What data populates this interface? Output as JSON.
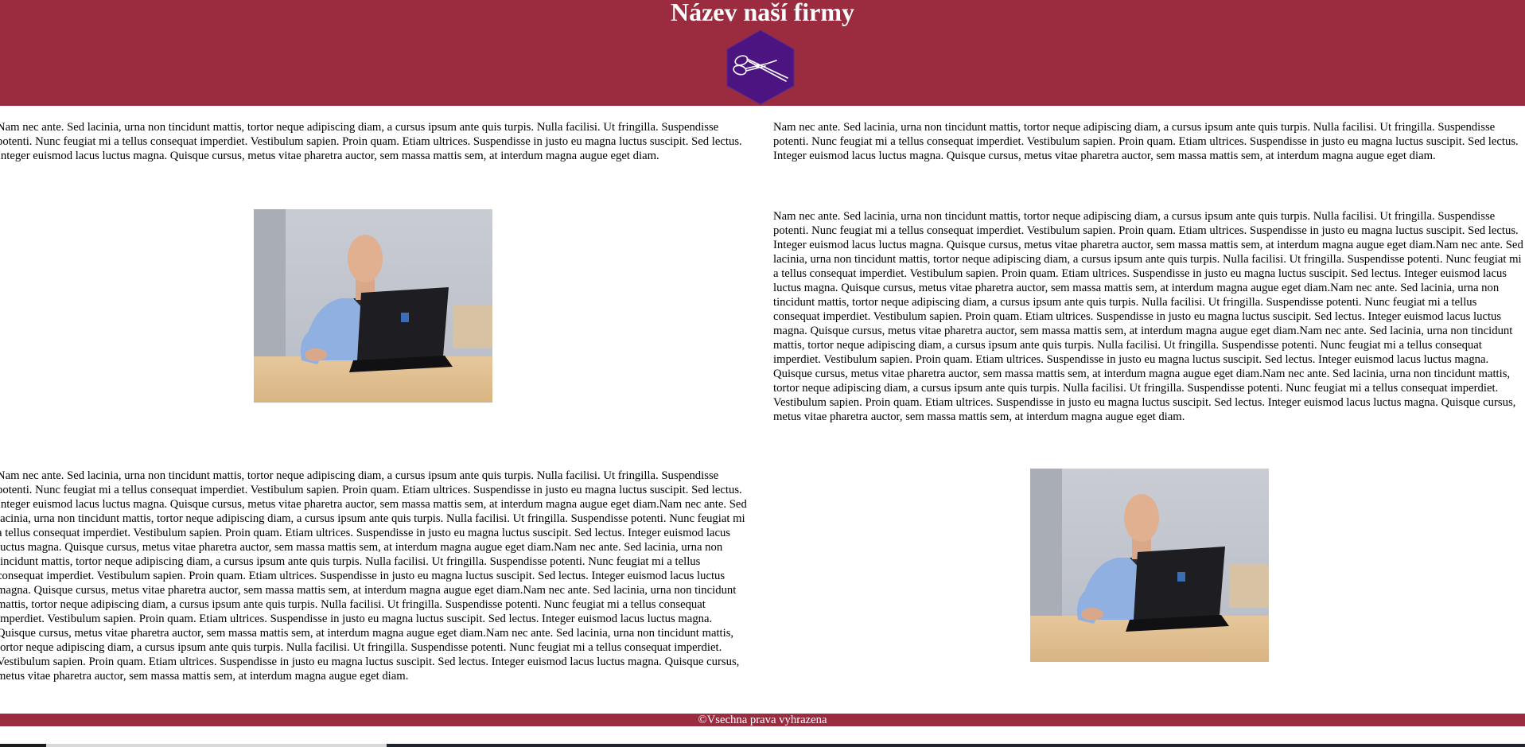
{
  "header": {
    "title": "Název naší firmy",
    "logo_icon": "scissors-hexagon-icon",
    "background_color": "#9b2b3f",
    "logo_color": "#4b1480"
  },
  "content": {
    "top_left_paragraph": "Nam nec ante. Sed lacinia, urna non tincidunt mattis, tortor neque adipiscing diam, a cursus ipsum ante quis turpis. Nulla facilisi. Ut fringilla. Suspendisse potenti. Nunc feugiat mi a tellus consequat imperdiet. Vestibulum sapien. Proin quam. Etiam ultrices. Suspendisse in justo eu magna luctus suscipit. Sed lectus. Integer euismod lacus luctus magna. Quisque cursus, metus vitae pharetra auctor, sem massa mattis sem, at interdum magna augue eget diam.",
    "top_right_paragraph": "Nam nec ante. Sed lacinia, urna non tincidunt mattis, tortor neque adipiscing diam, a cursus ipsum ante quis turpis. Nulla facilisi. Ut fringilla. Suspendisse potenti. Nunc feugiat mi a tellus consequat imperdiet. Vestibulum sapien. Proin quam. Etiam ultrices. Suspendisse in justo eu magna luctus suscipit. Sed lectus. Integer euismod lacus luctus magna. Quisque cursus, metus vitae pharetra auctor, sem massa mattis sem, at interdum magna augue eget diam.",
    "right_long_paragraph": "Nam nec ante. Sed lacinia, urna non tincidunt mattis, tortor neque adipiscing diam, a cursus ipsum ante quis turpis. Nulla facilisi. Ut fringilla. Suspendisse potenti. Nunc feugiat mi a tellus consequat imperdiet. Vestibulum sapien. Proin quam. Etiam ultrices. Suspendisse in justo eu magna luctus suscipit. Sed lectus. Integer euismod lacus luctus magna. Quisque cursus, metus vitae pharetra auctor, sem massa mattis sem, at interdum magna augue eget diam.Nam nec ante. Sed lacinia, urna non tincidunt mattis, tortor neque adipiscing diam, a cursus ipsum ante quis turpis. Nulla facilisi. Ut fringilla. Suspendisse potenti. Nunc feugiat mi a tellus consequat imperdiet. Vestibulum sapien. Proin quam. Etiam ultrices. Suspendisse in justo eu magna luctus suscipit. Sed lectus. Integer euismod lacus luctus magna. Quisque cursus, metus vitae pharetra auctor, sem massa mattis sem, at interdum magna augue eget diam.Nam nec ante. Sed lacinia, urna non tincidunt mattis, tortor neque adipiscing diam, a cursus ipsum ante quis turpis. Nulla facilisi. Ut fringilla. Suspendisse potenti. Nunc feugiat mi a tellus consequat imperdiet. Vestibulum sapien. Proin quam. Etiam ultrices. Suspendisse in justo eu magna luctus suscipit. Sed lectus. Integer euismod lacus luctus magna. Quisque cursus, metus vitae pharetra auctor, sem massa mattis sem, at interdum magna augue eget diam.Nam nec ante. Sed lacinia, urna non tincidunt mattis, tortor neque adipiscing diam, a cursus ipsum ante quis turpis. Nulla facilisi. Ut fringilla. Suspendisse potenti. Nunc feugiat mi a tellus consequat imperdiet. Vestibulum sapien. Proin quam. Etiam ultrices. Suspendisse in justo eu magna luctus suscipit. Sed lectus. Integer euismod lacus luctus magna. Quisque cursus, metus vitae pharetra auctor, sem massa mattis sem, at interdum magna augue eget diam.Nam nec ante. Sed lacinia, urna non tincidunt mattis, tortor neque adipiscing diam, a cursus ipsum ante quis turpis. Nulla facilisi. Ut fringilla. Suspendisse potenti. Nunc feugiat mi a tellus consequat imperdiet. Vestibulum sapien. Proin quam. Etiam ultrices. Suspendisse in justo eu magna luctus suscipit. Sed lectus. Integer euismod lacus luctus magna. Quisque cursus, metus vitae pharetra auctor, sem massa mattis sem, at interdum magna augue eget diam.",
    "left_long_paragraph": "Nam nec ante. Sed lacinia, urna non tincidunt mattis, tortor neque adipiscing diam, a cursus ipsum ante quis turpis. Nulla facilisi. Ut fringilla. Suspendisse potenti. Nunc feugiat mi a tellus consequat imperdiet. Vestibulum sapien. Proin quam. Etiam ultrices. Suspendisse in justo eu magna luctus suscipit. Sed lectus. Integer euismod lacus luctus magna. Quisque cursus, metus vitae pharetra auctor, sem massa mattis sem, at interdum magna augue eget diam.Nam nec ante. Sed lacinia, urna non tincidunt mattis, tortor neque adipiscing diam, a cursus ipsum ante quis turpis. Nulla facilisi. Ut fringilla. Suspendisse potenti. Nunc feugiat mi a tellus consequat imperdiet. Vestibulum sapien. Proin quam. Etiam ultrices. Suspendisse in justo eu magna luctus suscipit. Sed lectus. Integer euismod lacus luctus magna. Quisque cursus, metus vitae pharetra auctor, sem massa mattis sem, at interdum magna augue eget diam.Nam nec ante. Sed lacinia, urna non tincidunt mattis, tortor neque adipiscing diam, a cursus ipsum ante quis turpis. Nulla facilisi. Ut fringilla. Suspendisse potenti. Nunc feugiat mi a tellus consequat imperdiet. Vestibulum sapien. Proin quam. Etiam ultrices. Suspendisse in justo eu magna luctus suscipit. Sed lectus. Integer euismod lacus luctus magna. Quisque cursus, metus vitae pharetra auctor, sem massa mattis sem, at interdum magna augue eget diam.Nam nec ante. Sed lacinia, urna non tincidunt mattis, tortor neque adipiscing diam, a cursus ipsum ante quis turpis. Nulla facilisi. Ut fringilla. Suspendisse potenti. Nunc feugiat mi a tellus consequat imperdiet. Vestibulum sapien. Proin quam. Etiam ultrices. Suspendisse in justo eu magna luctus suscipit. Sed lectus. Integer euismod lacus luctus magna. Quisque cursus, metus vitae pharetra auctor, sem massa mattis sem, at interdum magna augue eget diam.Nam nec ante. Sed lacinia, urna non tincidunt mattis, tortor neque adipiscing diam, a cursus ipsum ante quis turpis. Nulla facilisi. Ut fringilla. Suspendisse potenti. Nunc feugiat mi a tellus consequat imperdiet. Vestibulum sapien. Proin quam. Etiam ultrices. Suspendisse in justo eu magna luctus suscipit. Sed lectus. Integer euismod lacus luctus magna. Quisque cursus, metus vitae pharetra auctor, sem massa mattis sem, at interdum magna augue eget diam."
  },
  "photos": {
    "left_icon": "person-with-laptop-photo",
    "right_icon": "person-with-laptop-photo"
  },
  "footer": {
    "text": "©Vsechna prava vyhrazena",
    "background_color": "#9b2b3f"
  }
}
